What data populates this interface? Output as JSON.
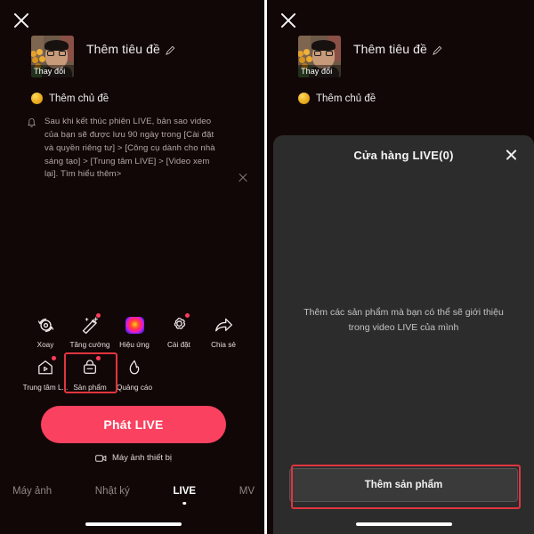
{
  "app": {
    "accent_red": "#fb4160",
    "highlight_box_color": "#e0353f",
    "sheet_bg": "#2c2c2c",
    "screen_bg": "#120707"
  },
  "left_panel": {
    "close_icon": "close-icon",
    "cover": {
      "change_label": "Thay đổi"
    },
    "title_label": "Thêm tiêu đề",
    "edit_icon": "pencil-icon",
    "topic": {
      "icon": "topic-coin-icon",
      "label": "Thêm chủ đề"
    },
    "notice": {
      "icon": "bell-icon",
      "text": "Sau khi kết thúc phiên LIVE, bản sao video của bạn sẽ được lưu 90 ngày trong [Cài đặt và quyền riêng tư] > [Công cụ dành cho nhà sáng tạo] > [Trung tâm LIVE] > [Video xem lại]. Tìm hiểu thêm>",
      "close_icon": "close-icon"
    },
    "tools_row1": [
      {
        "label": "Xoay",
        "icon": "flip-camera-icon",
        "badge": false
      },
      {
        "label": "Tăng cường",
        "icon": "magic-wand-icon",
        "badge": true
      },
      {
        "label": "Hiệu ứng",
        "icon": "effects-icon",
        "badge": false
      },
      {
        "label": "Cài đặt",
        "icon": "gear-icon",
        "badge": true
      },
      {
        "label": "Chia sẻ",
        "icon": "share-arrow-icon",
        "badge": false
      }
    ],
    "tools_row2": [
      {
        "label": "Trung tâm L...",
        "icon": "live-center-house-icon",
        "badge": true
      },
      {
        "label": "Sản phẩm",
        "icon": "shopping-bag-icon",
        "badge": true
      },
      {
        "label": "Quảng cáo",
        "icon": "flame-icon",
        "badge": false
      }
    ],
    "go_live_label": "Phát LIVE",
    "device_camera": {
      "icon": "video-camera-icon",
      "label": "Máy ảnh thiết bị"
    },
    "bottom_nav": [
      {
        "label": "Máy ảnh",
        "active": false
      },
      {
        "label": "Nhật ký",
        "active": false
      },
      {
        "label": "LIVE",
        "active": true
      },
      {
        "label": "MV",
        "active": false
      }
    ]
  },
  "right_panel": {
    "close_icon": "close-icon",
    "cover": {
      "change_label": "Thay đổi"
    },
    "title_label": "Thêm tiêu đề",
    "edit_icon": "pencil-icon",
    "topic": {
      "icon": "topic-coin-icon",
      "label": "Thêm chủ đề"
    },
    "sheet": {
      "title": "Cửa hàng LIVE(0)",
      "close_icon": "close-icon",
      "empty_text": "Thêm các sản phẩm mà bạn có thể sẽ giới thiệu trong video LIVE của mình",
      "add_button_label": "Thêm sản phẩm"
    }
  }
}
